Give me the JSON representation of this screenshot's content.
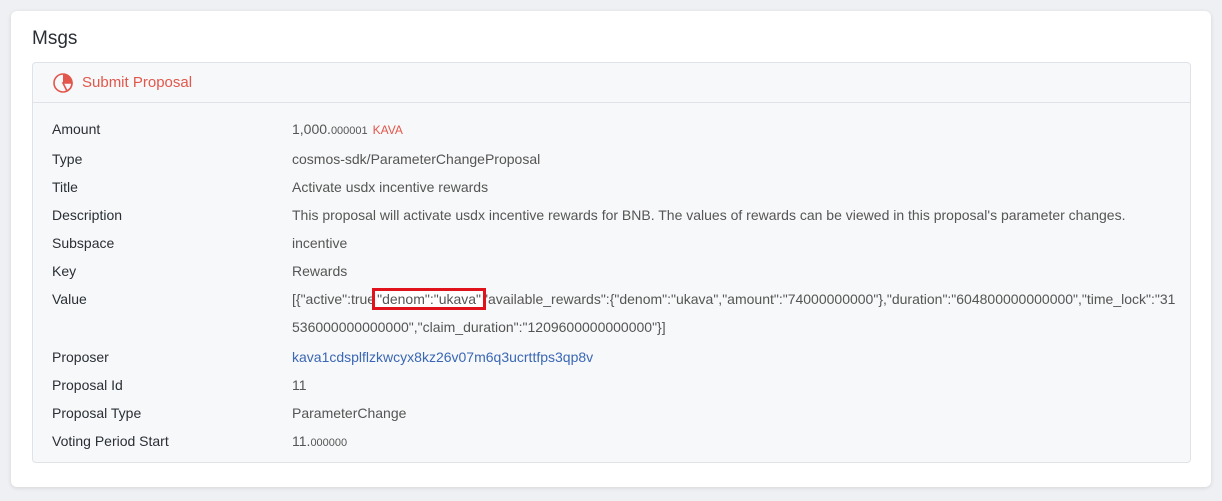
{
  "section_title": "Msgs",
  "message": {
    "type_label": "Submit Proposal",
    "icon": "pie-chart-icon",
    "accent_color": "#e2574c",
    "link_color": "#3a67b5",
    "highlight_color": "#e0121b",
    "fields": {
      "amount": {
        "label": "Amount",
        "int": "1,000.",
        "dec": "000001",
        "denom": "KAVA"
      },
      "type": {
        "label": "Type",
        "value": "cosmos-sdk/ParameterChangeProposal"
      },
      "title": {
        "label": "Title",
        "value": "Activate usdx incentive rewards"
      },
      "description": {
        "label": "Description",
        "value": "This proposal will activate usdx incentive rewards for BNB. The values of rewards can be viewed in this proposal's parameter changes."
      },
      "subspace": {
        "label": "Subspace",
        "value": "incentive"
      },
      "key": {
        "label": "Key",
        "value": "Rewards"
      },
      "value": {
        "label": "Value",
        "before": "[{\"active\":true",
        "highlight": "\"denom\":\"ukava\"",
        "after": "\"available_rewards\":{\"denom\":\"ukava\",\"amount\":\"74000000000\"},\"duration\":\"604800000000000\",\"time_lock\":\"31536000000000000\",\"claim_duration\":\"1209600000000000\"}]"
      },
      "proposer": {
        "label": "Proposer",
        "value": "kava1cdsplflzkwcyx8kz26v07m6q3ucrttfps3qp8v"
      },
      "proposal_id": {
        "label": "Proposal Id",
        "value": "11"
      },
      "proposal_type": {
        "label": "Proposal Type",
        "value": "ParameterChange"
      },
      "voting_period_start": {
        "label": "Voting Period Start",
        "int": "11.",
        "dec": "000000"
      }
    }
  }
}
